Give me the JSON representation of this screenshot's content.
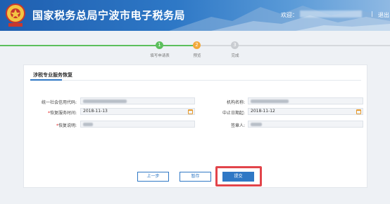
{
  "header": {
    "title": "国家税务总局宁波市电子税务局",
    "welcome": "欢迎：",
    "separator": "|",
    "logout": "退出"
  },
  "steps": [
    {
      "number": "1",
      "label": "填写申请表",
      "state": "done",
      "color": "#5cbf5c"
    },
    {
      "number": "2",
      "label": "预览",
      "state": "current",
      "color": "#f2a93b"
    },
    {
      "number": "3",
      "label": "完成",
      "state": "todo",
      "color": "#c9ccd1"
    }
  ],
  "form": {
    "title": "涉税专业服务恢复",
    "fields": {
      "credit_code": {
        "label": "统一社会信用代码:",
        "required": false,
        "value": ""
      },
      "org_name": {
        "label": "机构名称:",
        "required": false,
        "value": ""
      },
      "restore_date": {
        "label": "恢复服务时间:",
        "required": true,
        "value": "2018-11-13"
      },
      "suspend_date": {
        "label": "中止日期起:",
        "required": false,
        "value": "2018-11-12"
      },
      "restore_reason": {
        "label": "恢复说明:",
        "required": true,
        "value": ""
      },
      "signer": {
        "label": "签章人:",
        "required": false,
        "value": ""
      }
    }
  },
  "buttons": {
    "prev": "上一步",
    "save": "暂存",
    "submit": "提交"
  },
  "colors": {
    "accent": "#2f78c5",
    "required": "#e02020",
    "highlight": "#e2444a"
  }
}
